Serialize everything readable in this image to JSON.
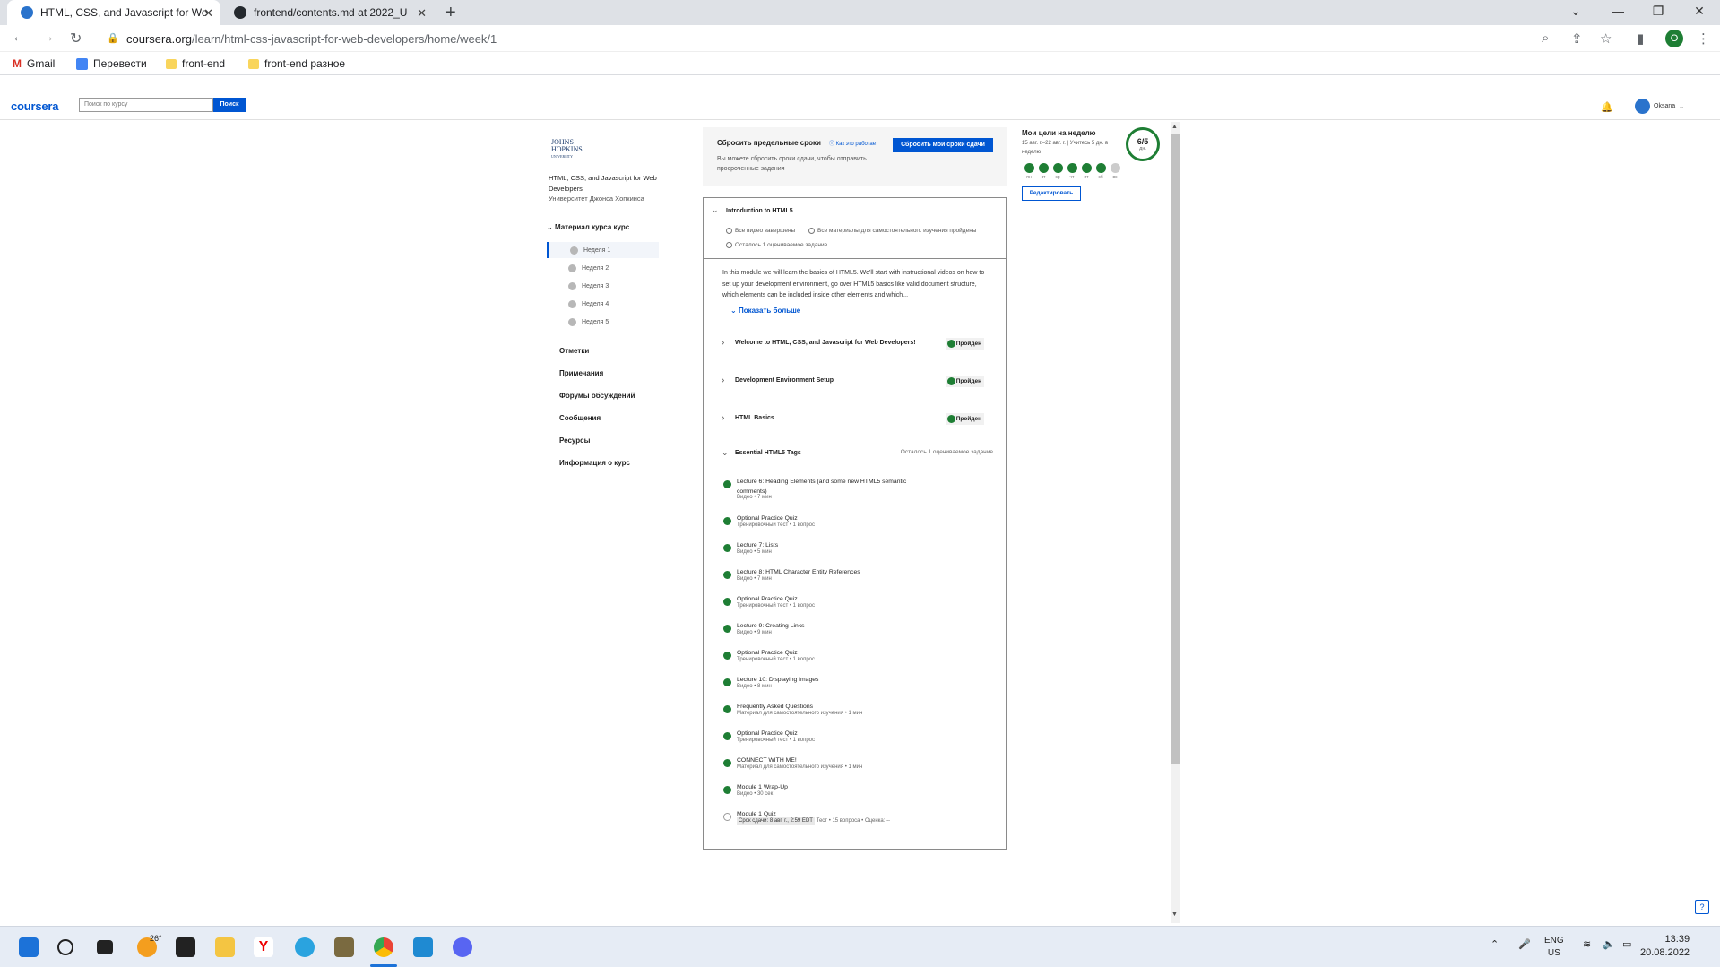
{
  "browser": {
    "tabs": [
      {
        "title": "HTML, CSS, and Javascript for We",
        "active": true
      },
      {
        "title": "frontend/contents.md at 2022_U",
        "active": false
      }
    ],
    "url_host": "coursera.org",
    "url_path": "/learn/html-css-javascript-for-web-developers/home/week/1",
    "profile_initial": "O",
    "bookmarks": [
      "Gmail",
      "Перевести",
      "front-end",
      "front-end разное"
    ]
  },
  "header": {
    "logo": "coursera",
    "search_placeholder": "Поиск по курсу",
    "search_button": "Поиск",
    "user_name": "Oksana"
  },
  "sidebar": {
    "university_logo": [
      "JOHNS",
      "HOPKINS",
      "UNIVERSITY"
    ],
    "course_title": "HTML, CSS, and Javascript for Web Developers",
    "university": "Университет Джонса Хопкинса",
    "material_label": "Материал курса курс",
    "weeks": [
      "Неделя 1",
      "Неделя 2",
      "Неделя 3",
      "Неделя 4",
      "Неделя 5"
    ],
    "links": [
      "Отметки",
      "Примечания",
      "Форумы обсуждений",
      "Сообщения",
      "Ресурсы",
      "Информация о курс"
    ]
  },
  "reset": {
    "title": "Сбросить предельные сроки",
    "how_link": "Как это работает",
    "button": "Сбросить мои сроки сдачи",
    "description": "Вы можете сбросить сроки сдачи, чтобы отправить просроченные задания"
  },
  "module": {
    "title": "Introduction to HTML5",
    "status_videos": "Все видео завершены",
    "status_materials": "Все материалы для самостоятельного изучения пройдены",
    "status_graded": "Осталось 1 оцениваемое задание",
    "description": "In this module we will learn the basics of HTML5. We'll start with instructional videos on how to set up your development environment, go over HTML5 basics like valid document structure, which elements can be included inside other elements and which...",
    "show_more": "Показать больше",
    "lessons": [
      {
        "title": "Welcome to HTML, CSS, and Javascript for Web Developers!",
        "status": "Пройден"
      },
      {
        "title": "Development Environment Setup",
        "status": "Пройден"
      },
      {
        "title": "HTML Basics",
        "status": "Пройден"
      }
    ],
    "section_title": "Essential HTML5 Tags",
    "section_remaining": "Осталось 1 оцениваемое задание",
    "items": [
      {
        "name": "Lecture 6: Heading Elements (and some new HTML5 semantic comments)",
        "sub": "Видео • 7 мин"
      },
      {
        "name": "Optional Practice Quiz",
        "sub": "Тренировочный тест • 1 вопрос"
      },
      {
        "name": "Lecture 7: Lists",
        "sub": "Видео • 5 мин"
      },
      {
        "name": "Lecture 8: HTML Character Entity References",
        "sub": "Видео • 7 мин"
      },
      {
        "name": "Optional Practice Quiz",
        "sub": "Тренировочный тест • 1 вопрос"
      },
      {
        "name": "Lecture 9: Creating Links",
        "sub": "Видео • 9 мин"
      },
      {
        "name": "Optional Practice Quiz",
        "sub": "Тренировочный тест • 1 вопрос"
      },
      {
        "name": "Lecture 10: Displaying Images",
        "sub": "Видео • 8 мин"
      },
      {
        "name": "Frequently Asked Questions",
        "sub": "Материал для самостоятельного изучения • 1 мин"
      },
      {
        "name": "Optional Practice Quiz",
        "sub": "Тренировочный тест • 1 вопрос"
      },
      {
        "name": "CONNECT WITH ME!",
        "sub": "Материал для самостоятельного изучения • 1 мин"
      },
      {
        "name": "Module 1 Wrap-Up",
        "sub": "Видео • 30 сек"
      },
      {
        "name": "Module 1 Quiz",
        "deadline": "Срок сдачи: 8 авг. г., 2:59 EDT",
        "sub": "Тест • 15 вопроса • Оценка: --"
      }
    ]
  },
  "goals": {
    "title": "Мои цели на неделю",
    "subtitle": "15 авг. г.–22 авг. г. | Учитесь 5 дн. в неделю",
    "progress": "6/5",
    "progress_unit": "дн.",
    "days": [
      "пн",
      "вт",
      "ср",
      "чт",
      "пт",
      "сб",
      "вс"
    ],
    "days_done": [
      true,
      true,
      true,
      true,
      true,
      true,
      false
    ],
    "edit_button": "Редактировать"
  },
  "taskbar": {
    "weather": "26°",
    "lang_top": "ENG",
    "lang_bottom": "US",
    "time": "13:39",
    "date": "20.08.2022"
  },
  "colors": {
    "coursera_blue": "#0056d2",
    "complete_green": "#1e7e34"
  }
}
